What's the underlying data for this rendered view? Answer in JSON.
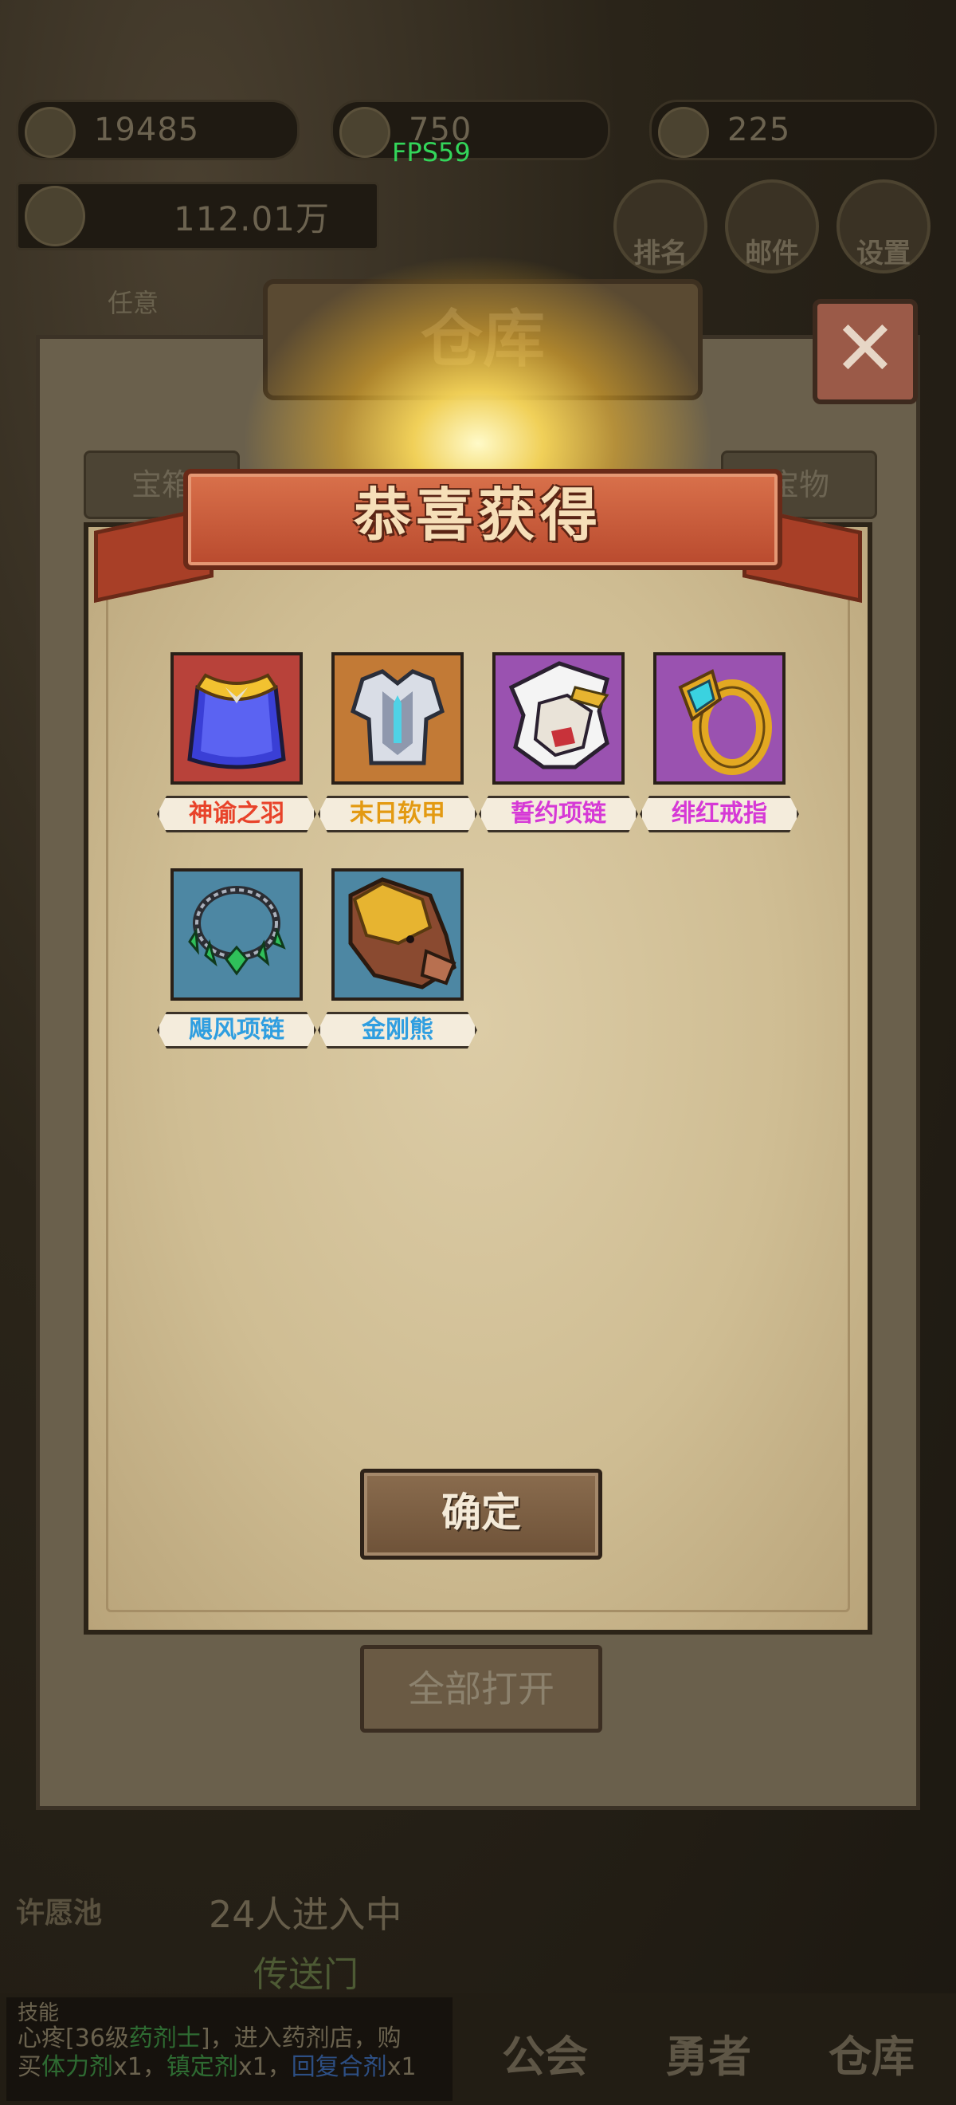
{
  "hud": {
    "coins": "19485",
    "gems": "750",
    "energy": "225",
    "power": "112.01万",
    "fps": "FPS59",
    "rank_label": "排名",
    "mail_label": "邮件",
    "settings_label": "设置",
    "quest_label": "任意"
  },
  "warehouse": {
    "title": "仓库",
    "tab_chest": "宝箱",
    "tab_treasure": "宝物",
    "open_all_label": "全部打开"
  },
  "popup": {
    "title": "恭喜获得",
    "confirm_label": "确定",
    "items": [
      {
        "name": "神谕之羽",
        "icon": "cape-icon",
        "name_color": "#e8432a",
        "frame_color": "#b8423a"
      },
      {
        "name": "末日软甲",
        "icon": "armor-icon",
        "name_color": "#e39a12",
        "frame_color": "#c27a36"
      },
      {
        "name": "誓约项链",
        "icon": "white-lion-icon",
        "name_color": "#d639d6",
        "frame_color": "#9a52b0"
      },
      {
        "name": "绯红戒指",
        "icon": "ring-icon",
        "name_color": "#d639d6",
        "frame_color": "#9a52b0"
      },
      {
        "name": "飓风项链",
        "icon": "emerald-necklace-icon",
        "name_color": "#2f9ee0",
        "frame_color": "#4d87a3"
      },
      {
        "name": "金刚熊",
        "icon": "boar-icon",
        "name_color": "#2f9ee0",
        "frame_color": "#4d87a3"
      }
    ]
  },
  "bottom": {
    "wish_pool": "许愿池",
    "crowd": "24人进入中",
    "portal": "传送门",
    "nav_guild": "公会",
    "nav_hero": "勇者",
    "nav_warehouse": "仓库",
    "log_title": "技能",
    "log_line1_a": "心疼[36级",
    "log_line1_b": "药剂士",
    "log_line1_c": "]，进入药剂店，购",
    "log_line2_a": "买",
    "log_line2_b": "体力剂",
    "log_line2_c": "x1，",
    "log_line2_d": "镇定剂",
    "log_line2_e": "x1，",
    "log_line2_f": "回复合剂",
    "log_line2_g": "x1"
  }
}
